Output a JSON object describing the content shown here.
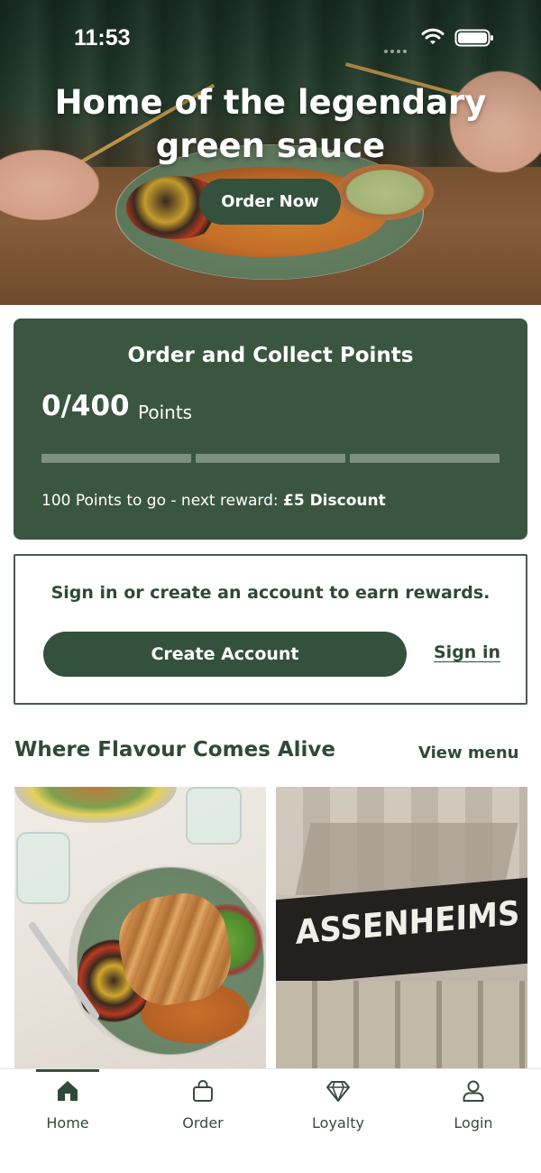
{
  "status_bar": {
    "time": "11:53"
  },
  "hero": {
    "title_line1": "Home of the legendary",
    "title_line2": "green sauce",
    "cta_label": "Order Now"
  },
  "points_card": {
    "title": "Order and Collect Points",
    "points_value": "0/400",
    "points_unit": "Points",
    "progress_fraction": 0,
    "progress_segments": 3,
    "next_reward_prefix": "100 Points to go - next reward: ",
    "next_reward_value": "£5 Discount"
  },
  "signin_card": {
    "prompt": "Sign in or create an account to earn rewards.",
    "create_account_label": "Create Account",
    "sign_in_label": "Sign in"
  },
  "section": {
    "title": "Where Flavour Comes Alive",
    "link_label": "View menu"
  },
  "tiles": {
    "sign_text": "ASSENHEIMS"
  },
  "bottom_nav": {
    "items": [
      {
        "label": "Home",
        "icon": "home-icon",
        "active": true
      },
      {
        "label": "Order",
        "icon": "bag-icon",
        "active": false
      },
      {
        "label": "Loyalty",
        "icon": "diamond-icon",
        "active": false
      },
      {
        "label": "Login",
        "icon": "user-icon",
        "active": false
      }
    ]
  },
  "colors": {
    "brand_green": "#34513d",
    "card_green": "#3b5640",
    "text_green": "#2f4a38",
    "progress_track": "#7e917f"
  }
}
